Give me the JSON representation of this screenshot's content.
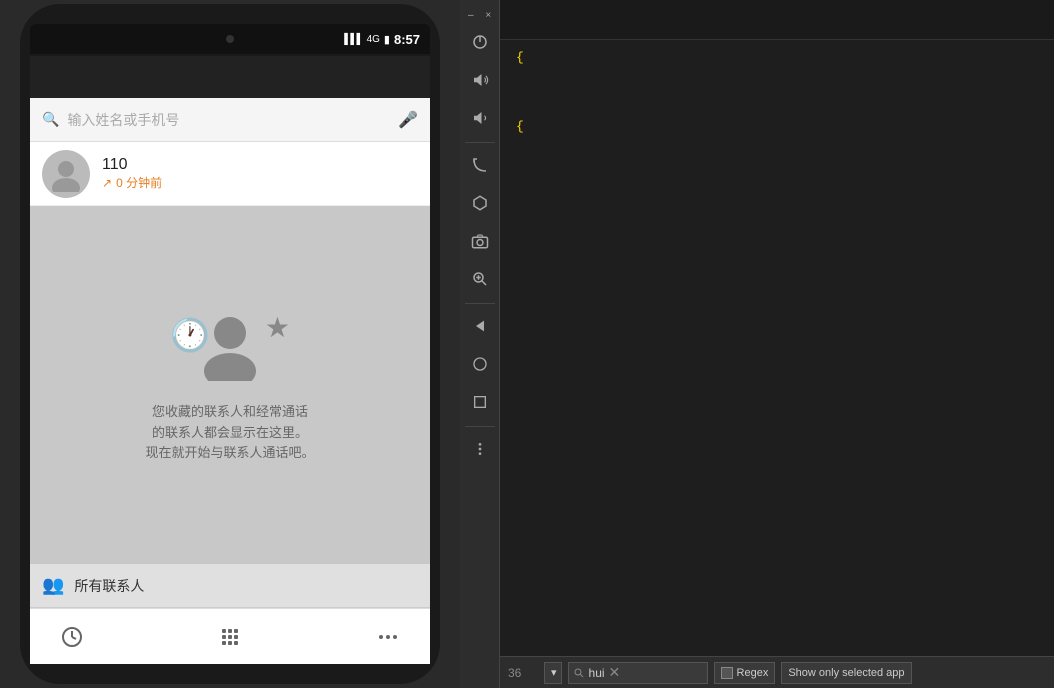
{
  "phone": {
    "status_bar": {
      "signal": "▌▌▌",
      "battery_icon": "🔋",
      "time": "8:57"
    },
    "search_placeholder": "输入姓名或手机号",
    "contact": {
      "name": "110",
      "sub_text": "0 分钟前"
    },
    "empty_state_text": "您收藏的联系人和经常通话\n的联系人都会显示在这里。\n现在就开始与联系人通话吧。",
    "contacts_tab_label": "所有联系人"
  },
  "emulator_toolbar": {
    "window_buttons": {
      "minimize": "–",
      "close": "×"
    },
    "buttons": [
      {
        "icon": "⏻",
        "name": "power"
      },
      {
        "icon": "🔊",
        "name": "volume-up"
      },
      {
        "icon": "🔉",
        "name": "volume-down"
      },
      {
        "icon": "◆",
        "name": "rotate"
      },
      {
        "icon": "◇",
        "name": "screenshot-rotated"
      },
      {
        "icon": "📷",
        "name": "camera"
      },
      {
        "icon": "🔍",
        "name": "zoom"
      },
      {
        "icon": "◁",
        "name": "back"
      },
      {
        "icon": "○",
        "name": "home"
      },
      {
        "icon": "□",
        "name": "recents"
      },
      {
        "icon": "•••",
        "name": "more"
      }
    ]
  },
  "ide": {
    "code_lines": [
      "{",
      "{"
    ],
    "bottom_bar": {
      "line_number": "36",
      "filter_value": "",
      "search_value": "hui",
      "regex_label": "Regex",
      "show_selected_label": "Show only selected app"
    }
  }
}
